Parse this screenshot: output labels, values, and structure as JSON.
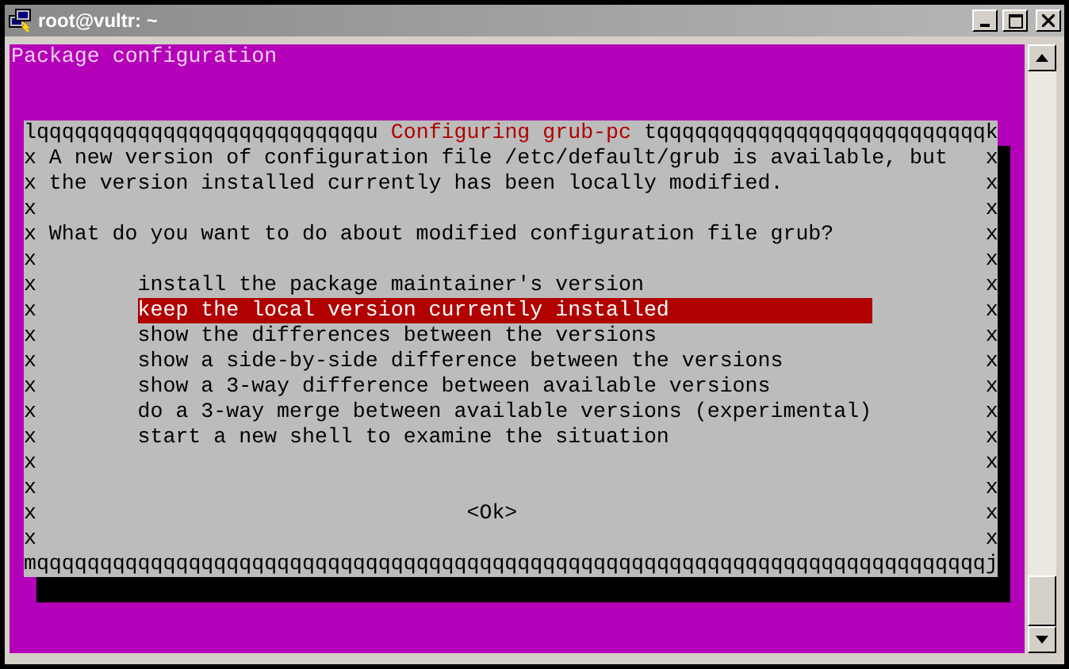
{
  "window": {
    "title": "root@vultr: ~"
  },
  "terminal": {
    "header": "Package configuration",
    "dialog": {
      "border_top_left": "lqqqqqqqqqqqqqqqqqqqqqqqqqqu",
      "title": "Configuring grub-pc",
      "border_top_right": "tqqqqqqqqqqqqqqqqqqqqqqqqqqk",
      "rows": [
        {
          "kind": "text",
          "left": "x",
          "text": "A new version of configuration file /etc/default/grub is available, but",
          "right": "x"
        },
        {
          "kind": "text",
          "left": "x",
          "text": "the version installed currently has been locally modified.",
          "right": "x"
        },
        {
          "kind": "blank",
          "left": "x",
          "right": "x"
        },
        {
          "kind": "text",
          "left": "x",
          "text": "What do you want to do about modified configuration file grub?",
          "right": "x"
        },
        {
          "kind": "blank",
          "left": "x",
          "right": "x"
        },
        {
          "kind": "choice",
          "left": "x",
          "text": "install the package maintainer's version",
          "selected": false,
          "right": "x"
        },
        {
          "kind": "choice",
          "left": "x",
          "text": "keep the local version currently installed",
          "selected": true,
          "right": "x"
        },
        {
          "kind": "choice",
          "left": "x",
          "text": "show the differences between the versions",
          "selected": false,
          "right": "x"
        },
        {
          "kind": "choice",
          "left": "x",
          "text": "show a side-by-side difference between the versions",
          "selected": false,
          "right": "x"
        },
        {
          "kind": "choice",
          "left": "x",
          "text": "show a 3-way difference between available versions",
          "selected": false,
          "right": "x"
        },
        {
          "kind": "choice",
          "left": "x",
          "text": "do a 3-way merge between available versions (experimental)",
          "selected": false,
          "right": "x"
        },
        {
          "kind": "choice",
          "left": "x",
          "text": "start a new shell to examine the situation",
          "selected": false,
          "right": "x"
        },
        {
          "kind": "blank",
          "left": "x",
          "right": "x"
        },
        {
          "kind": "blank",
          "left": "x",
          "right": "x"
        },
        {
          "kind": "button",
          "left": "x",
          "text": "<Ok>",
          "right": "x"
        },
        {
          "kind": "blank",
          "left": "x",
          "right": "x"
        }
      ],
      "border_bottom": "mqqqqqqqqqqqqqqqqqqqqqqqqqqqqqqqqqqqqqqqqqqqqqqqqqqqqqqqqqqqqqqqqqqqqqqqqqqqj"
    }
  }
}
